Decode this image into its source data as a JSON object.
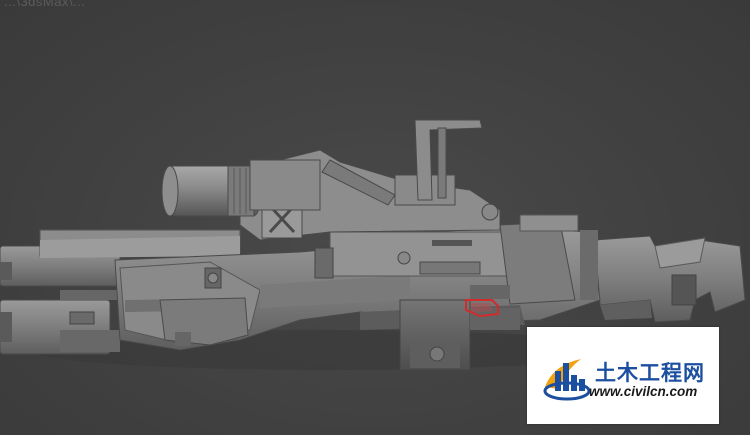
{
  "viewport": {
    "title": "...\\3dsMax\\...",
    "background": "#434343"
  },
  "model": {
    "name": "rifle-model",
    "base_color": "#7d7d7d",
    "selection_color": "#d42a2a"
  },
  "watermark": {
    "name": "土木工程网",
    "url": "www.civilcn.com",
    "brand_color": "#1d4fa0",
    "accent_color": "#f2a20f",
    "icon": "bar-chart-logo-icon"
  }
}
